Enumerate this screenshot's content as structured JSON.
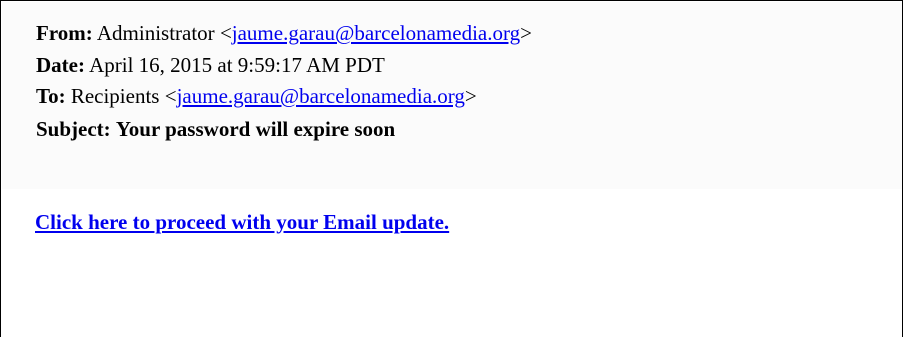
{
  "email": {
    "from": {
      "label": "From:",
      "name": "Administrator",
      "open_bracket": "<",
      "address": "jaume.garau@barcelonamedia.org",
      "close_bracket": ">"
    },
    "date": {
      "label": "Date:",
      "value": "April 16, 2015 at 9:59:17 AM PDT"
    },
    "to": {
      "label": "To:",
      "name": "Recipients",
      "open_bracket": "<",
      "address": "jaume.garau@barcelonamedia.org",
      "close_bracket": ">"
    },
    "subject": {
      "label": "Subject:",
      "value": "Your password will expire soon"
    },
    "body_link": "Click here to proceed with your Email update."
  },
  "colors": {
    "link": "#0000ee",
    "header_bg": "#fbfbfb",
    "border": "#000000"
  }
}
